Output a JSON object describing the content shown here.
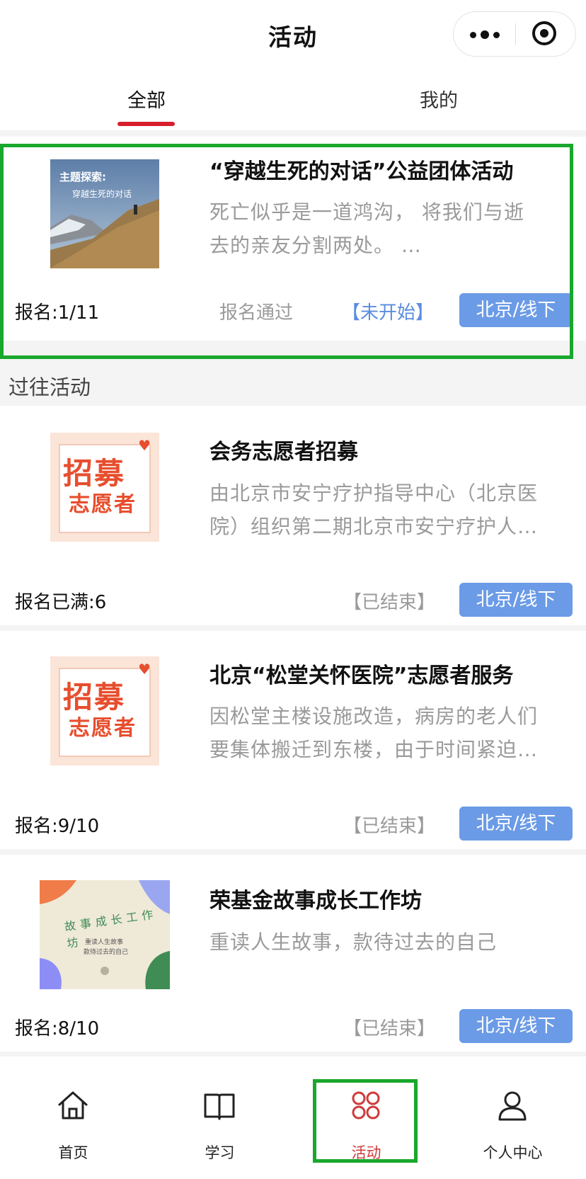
{
  "header": {
    "title": "活动",
    "more_icon": "more-dots-icon",
    "close_icon": "target-icon"
  },
  "tabs": [
    {
      "label": "全部",
      "active": true
    },
    {
      "label": "我的",
      "active": false
    }
  ],
  "current_activities": [
    {
      "title": "“穿越生死的对话”公益团体活动",
      "desc_line1": "死亡似乎是一道鸿沟， 将我们与逝",
      "desc_line2": "去的亲友分割两处。 …",
      "thumb_caption_1": "主题探索:",
      "thumb_caption_2": "穿越生死的对话",
      "count": "报名:1/11",
      "approved": "报名通过",
      "status": "【未开始】",
      "location": "北京/线下"
    }
  ],
  "past_section_label": "过往活动",
  "past_activities": [
    {
      "title": "会务志愿者招募",
      "desc_line1": "由北京市安宁疗护指导中心（北京医",
      "desc_line2": "院）组织第二期北京市安宁疗护人…",
      "thumb_t1": "招募",
      "thumb_t2": "志愿者",
      "count": "报名已满:6",
      "status": "【已结束】",
      "location": "北京/线下"
    },
    {
      "title": "北京“松堂关怀医院”志愿者服务",
      "desc_line1": "因松堂主楼设施改造，病房的老人们",
      "desc_line2": "要集体搬迁到东楼，由于时间紧迫…",
      "thumb_t1": "招募",
      "thumb_t2": "志愿者",
      "count": "报名:9/10",
      "status": "【已结束】",
      "location": "北京/线下"
    },
    {
      "title": "荣基金故事成长工作坊",
      "desc_line1": "重读人生故事，款待过去的自己",
      "thumb_arc": "故事成长工作坊",
      "thumb_small_1": "重读人生故事",
      "thumb_small_2": "款待过去的自己",
      "count": "报名:8/10",
      "status": "【已结束】",
      "location": "北京/线下"
    }
  ],
  "bottom_nav": [
    {
      "label": "首页",
      "icon": "home-icon"
    },
    {
      "label": "学习",
      "icon": "book-icon"
    },
    {
      "label": "活动",
      "icon": "activity-icon",
      "active": true
    },
    {
      "label": "个人中心",
      "icon": "user-icon"
    }
  ],
  "colors": {
    "accent_red": "#d81e2c",
    "location_blue": "#6b9be6",
    "highlight_green": "#19a72c"
  }
}
